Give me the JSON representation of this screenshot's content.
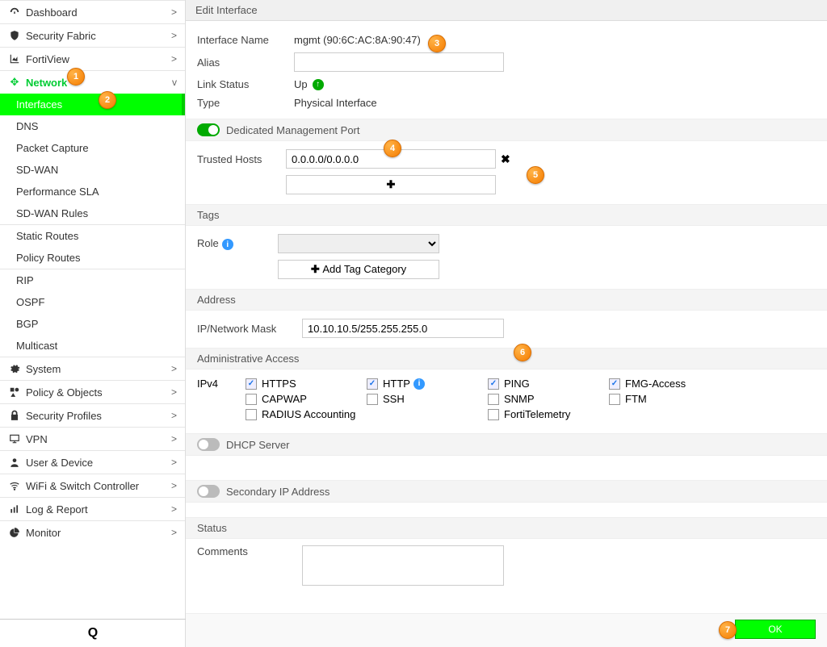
{
  "sidebar": {
    "items": [
      {
        "icon": "tachometer",
        "label": "Dashboard",
        "expand": ">"
      },
      {
        "icon": "shield",
        "label": "Security Fabric",
        "expand": ">"
      },
      {
        "icon": "chart",
        "label": "FortiView",
        "expand": ">"
      },
      {
        "icon": "arrows",
        "label": "Network",
        "expand": "v",
        "active": true
      }
    ],
    "network_sub": [
      "Interfaces",
      "DNS",
      "Packet Capture",
      "SD-WAN",
      "Performance SLA",
      "SD-WAN Rules",
      "Static Routes",
      "Policy Routes",
      "RIP",
      "OSPF",
      "BGP",
      "Multicast"
    ],
    "items2": [
      {
        "icon": "gear",
        "label": "System"
      },
      {
        "icon": "shapes",
        "label": "Policy & Objects"
      },
      {
        "icon": "lock",
        "label": "Security Profiles"
      },
      {
        "icon": "monitor",
        "label": "VPN"
      },
      {
        "icon": "user",
        "label": "User & Device"
      },
      {
        "icon": "wifi",
        "label": "WiFi & Switch Controller"
      },
      {
        "icon": "bars",
        "label": "Log & Report"
      },
      {
        "icon": "pie",
        "label": "Monitor"
      }
    ],
    "search_icon": "Q"
  },
  "header": {
    "title": "Edit Interface"
  },
  "fields": {
    "interface_name_label": "Interface Name",
    "interface_name_value": "mgmt (90:6C:AC:8A:90:47)",
    "alias_label": "Alias",
    "alias_value": "",
    "link_status_label": "Link Status",
    "link_status_value": "Up",
    "type_label": "Type",
    "type_value": "Physical Interface",
    "dedicated_label": "Dedicated Management Port",
    "trusted_label": "Trusted Hosts",
    "trusted_value": "0.0.0.0/0.0.0.0",
    "tags_header": "Tags",
    "role_label": "Role",
    "add_tag_label": "Add Tag Category",
    "address_header": "Address",
    "ipmask_label": "IP/Network Mask",
    "ipmask_value": "10.10.10.5/255.255.255.0",
    "admin_header": "Administrative Access",
    "ipv4_label": "IPv4",
    "dhcp_label": "DHCP Server",
    "secip_label": "Secondary IP Address",
    "status_header": "Status",
    "comments_label": "Comments",
    "ok_label": "OK"
  },
  "access": {
    "r1": [
      {
        "l": "HTTPS",
        "c": true
      },
      {
        "l": "HTTP",
        "c": true,
        "info": true
      },
      {
        "l": "PING",
        "c": true
      },
      {
        "l": "FMG-Access",
        "c": true
      }
    ],
    "r2": [
      {
        "l": "CAPWAP",
        "c": false
      },
      {
        "l": "SSH",
        "c": false
      },
      {
        "l": "SNMP",
        "c": false
      },
      {
        "l": "FTM",
        "c": false
      }
    ],
    "r3": [
      {
        "l": "RADIUS Accounting",
        "c": false
      },
      {
        "l": "",
        "c": null
      },
      {
        "l": "FortiTelemetry",
        "c": false
      }
    ]
  },
  "callouts": {
    "1": "1",
    "2": "2",
    "3": "3",
    "4": "4",
    "5": "5",
    "6": "6",
    "7": "7"
  }
}
